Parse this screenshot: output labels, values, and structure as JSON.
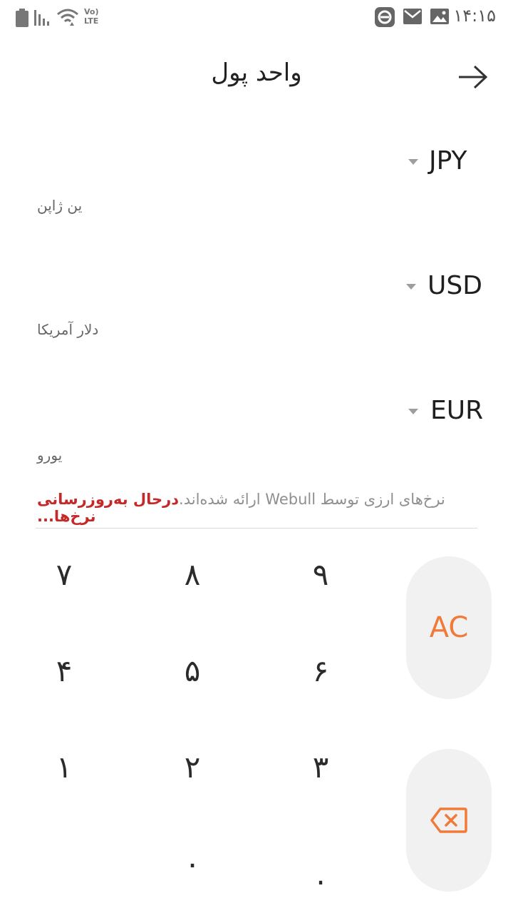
{
  "status_bar": {
    "time": "۱۴:۱۵",
    "left_icons": [
      "battery-icon",
      "signal-icon",
      "wifi-icon",
      "volte-icon"
    ],
    "volte_label": "Vo) LTE",
    "right_icons": [
      "app-notification-icon",
      "mail-icon",
      "gallery-icon"
    ]
  },
  "header": {
    "title": "واحد پول",
    "back_icon": "arrow-right-icon"
  },
  "currencies": [
    {
      "code": "JPY",
      "name": "ین ژاپن"
    },
    {
      "code": "USD",
      "name": "دلار آمریکا"
    },
    {
      "code": "EUR",
      "name": "یورو"
    }
  ],
  "notice": {
    "provider_text": "نرخ‌های ارزی توسط Webull ارائه شده‌اند.",
    "status_text": "درحال به‌روزرسانی نرخ‌ها..."
  },
  "keypad": {
    "keys": [
      "۷",
      "۸",
      "۹",
      "۴",
      "۵",
      "۶",
      "۱",
      "۲",
      "۳",
      "۰",
      "."
    ],
    "clear_label": "AC",
    "backspace_icon": "backspace-icon",
    "accent_color": "#f07a38"
  }
}
